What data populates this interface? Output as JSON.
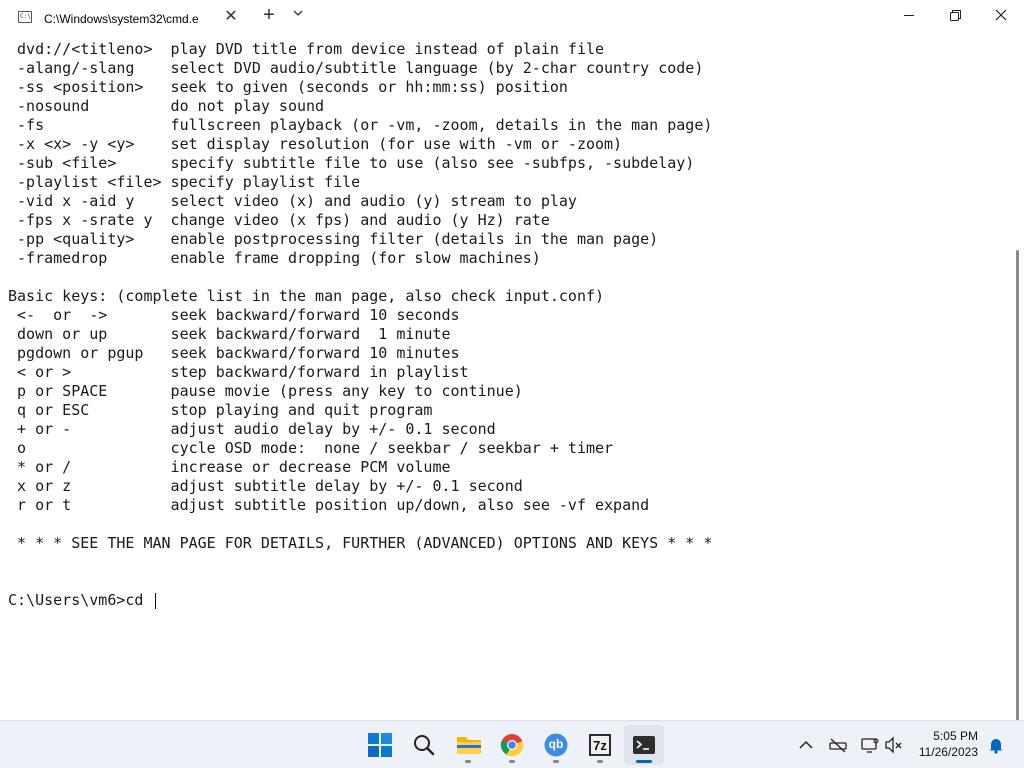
{
  "window": {
    "tab_title": "C:\\Windows\\system32\\cmd.e",
    "tab_icon_text": "C:\\"
  },
  "terminal": {
    "lines": [
      " dvd://<titleno>  play DVD title from device instead of plain file",
      " -alang/-slang    select DVD audio/subtitle language (by 2-char country code)",
      " -ss <position>   seek to given (seconds or hh:mm:ss) position",
      " -nosound         do not play sound",
      " -fs              fullscreen playback (or -vm, -zoom, details in the man page)",
      " -x <x> -y <y>    set display resolution (for use with -vm or -zoom)",
      " -sub <file>      specify subtitle file to use (also see -subfps, -subdelay)",
      " -playlist <file> specify playlist file",
      " -vid x -aid y    select video (x) and audio (y) stream to play",
      " -fps x -srate y  change video (x fps) and audio (y Hz) rate",
      " -pp <quality>    enable postprocessing filter (details in the man page)",
      " -framedrop       enable frame dropping (for slow machines)",
      "",
      "Basic keys: (complete list in the man page, also check input.conf)",
      " <-  or  ->       seek backward/forward 10 seconds",
      " down or up       seek backward/forward  1 minute",
      " pgdown or pgup   seek backward/forward 10 minutes",
      " < or >           step backward/forward in playlist",
      " p or SPACE       pause movie (press any key to continue)",
      " q or ESC         stop playing and quit program",
      " + or -           adjust audio delay by +/- 0.1 second",
      " o                cycle OSD mode:  none / seekbar / seekbar + timer",
      " * or /           increase or decrease PCM volume",
      " x or z           adjust subtitle delay by +/- 0.1 second",
      " r or t           adjust subtitle position up/down, also see -vf expand",
      "",
      " * * * SEE THE MAN PAGE FOR DETAILS, FURTHER (ADVANCED) OPTIONS AND KEYS * * *",
      "",
      ""
    ],
    "prompt": "C:\\Users\\vm6>cd "
  },
  "taskbar": {
    "apps": [
      {
        "name": "start-button",
        "icon": "windows-logo-icon"
      },
      {
        "name": "search-button",
        "icon": "search-icon"
      },
      {
        "name": "file-explorer",
        "icon": "folder-icon"
      },
      {
        "name": "chrome",
        "icon": "chrome-icon"
      },
      {
        "name": "qbittorrent",
        "icon": "qbittorrent-icon",
        "label": "qb"
      },
      {
        "name": "7zip",
        "icon": "7zip-icon",
        "label": "7z"
      },
      {
        "name": "terminal",
        "icon": "terminal-icon"
      }
    ],
    "clock": {
      "time": "5:05 PM",
      "date": "11/26/2023"
    }
  },
  "colors": {
    "terminal_bg": "#ffffff",
    "terminal_text": "#1a1a1a",
    "taskbar_bg": "#eef2f8",
    "accent": "#0067c0"
  }
}
